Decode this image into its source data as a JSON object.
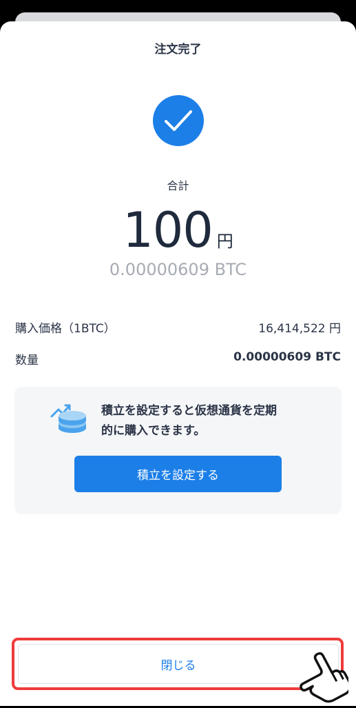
{
  "header": {
    "title": "注文完了"
  },
  "summary": {
    "total_label": "合計",
    "amount": "100",
    "amount_unit": "円",
    "btc_amount": "0.00000609 BTC"
  },
  "details": [
    {
      "label": "購入価格（1BTC）",
      "value": "16,414,522 円"
    },
    {
      "label": "数量",
      "value": "0.00000609 BTC"
    }
  ],
  "promo": {
    "icon": "coins-growth-icon",
    "text_line1": "積立を設定すると仮想通貨を定期",
    "text_line2": "的に購入できます。",
    "button_label": "積立を設定する"
  },
  "footer": {
    "close_label": "閉じる"
  },
  "colors": {
    "accent": "#1c7fe8",
    "highlight": "#ee3b3b",
    "text": "#2b3447",
    "muted": "#a7abb3"
  }
}
